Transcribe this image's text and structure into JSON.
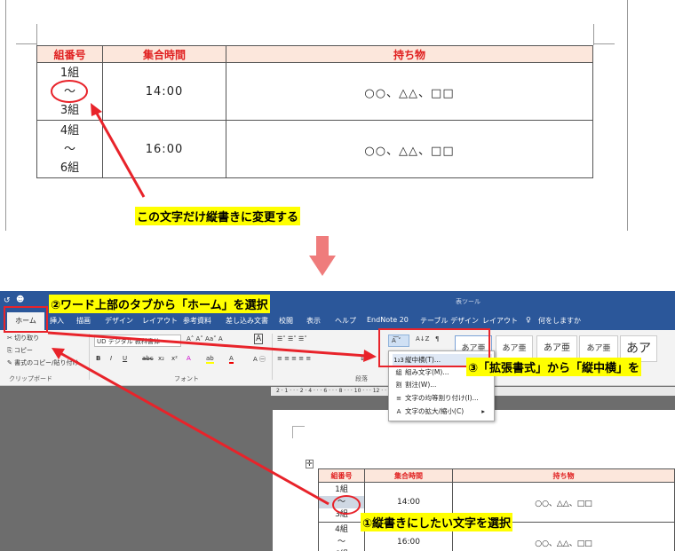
{
  "table": {
    "headers": [
      "組番号",
      "集合時間",
      "持ち物"
    ],
    "rows": [
      {
        "group_top": "1組",
        "tilde": "～",
        "group_bottom": "3組",
        "time": "14:00",
        "items": "○○、△△、□□"
      },
      {
        "group_top": "4組",
        "tilde": "～",
        "group_bottom": "6組",
        "time": "16:00",
        "items": "○○、△△、□□"
      }
    ]
  },
  "callouts": {
    "change_vertical": "この文字だけ縦書きに変更する",
    "step2": "②ワード上部のタブから「ホーム」を選択",
    "step3": "③「拡張書式」から「縦中横」を",
    "step1": "①縦書きにしたい文字を選択"
  },
  "word": {
    "context_tab_title": "表ツール",
    "tabs": [
      "ホーム",
      "挿入",
      "描画",
      "デザイン",
      "レイアウト",
      "参考資料",
      "差し込み文書",
      "校閲",
      "表示",
      "ヘルプ",
      "EndNote 20",
      "テーブル デザイン",
      "レイアウト"
    ],
    "tell_me": "何をしますか",
    "clipboard": {
      "cut": "切り取り",
      "copy": "コピー",
      "format_painter": "書式のコピー/貼り付け",
      "group_label": "クリップボード"
    },
    "font": {
      "font_name": "UD デジタル 教科書体",
      "group_label": "フォント",
      "format_buttons": [
        "B",
        "I",
        "U",
        "abc",
        "x₂",
        "x²"
      ]
    },
    "paragraph": {
      "group_label": "段落"
    },
    "styles": [
      "あア亜",
      "あア亜",
      "あア亜",
      "あア亜",
      "あア"
    ],
    "dropdown": [
      {
        "icon": "1₂3",
        "label": "縦中横(T)..."
      },
      {
        "icon": "組",
        "label": "組み文字(M)..."
      },
      {
        "icon": "割",
        "label": "割注(W)..."
      },
      {
        "icon": "≡",
        "label": "文字の均等割り付け(I)..."
      },
      {
        "icon": "A",
        "label": "文字の拡大/縮小(C)"
      }
    ],
    "ruler_text": "2 · 1 · · · 2 · 4 · · · 6 · · · 8 · · · 10 · · · 12 · · · 14"
  },
  "colors": {
    "word_blue": "#2b579a",
    "header_red": "#e02020",
    "annotation_red": "#e8232a",
    "highlight_yellow": "#ffff00",
    "arrow_pink": "#ef7c7c"
  }
}
